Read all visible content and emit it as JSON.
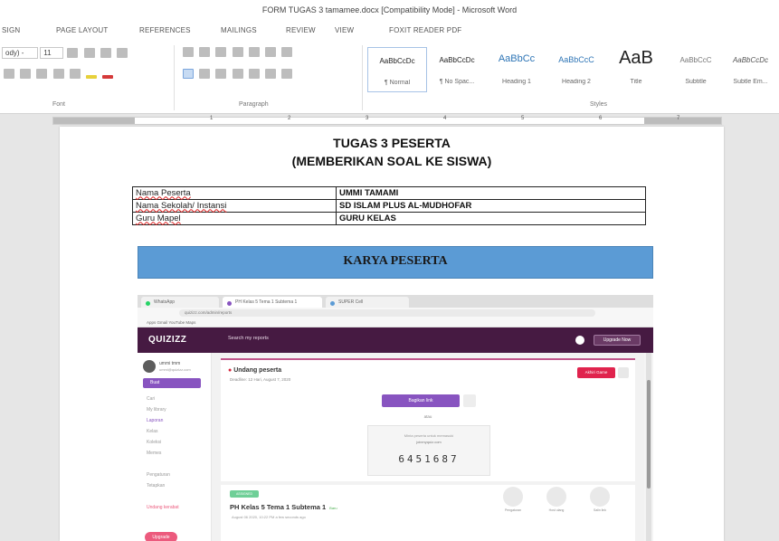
{
  "window": {
    "title": "FORM TUGAS 3 tamamee.docx [Compatibility Mode] - Microsoft Word"
  },
  "ribbon_tabs": [
    "SIGN",
    "PAGE LAYOUT",
    "REFERENCES",
    "MAILINGS",
    "REVIEW",
    "VIEW",
    "FOXIT READER PDF"
  ],
  "font_group": {
    "font_name": "ody) -",
    "font_size": "11",
    "label": "Font"
  },
  "paragraph_group": {
    "label": "Paragraph"
  },
  "styles_group": {
    "label": "Styles",
    "styles": [
      {
        "sample": "AaBbCcDc",
        "name": "¶ Normal"
      },
      {
        "sample": "AaBbCcDc",
        "name": "¶ No Spac..."
      },
      {
        "sample": "AaBbCc",
        "name": "Heading 1"
      },
      {
        "sample": "AaBbCcC",
        "name": "Heading 2"
      },
      {
        "sample": "AaB",
        "name": "Title"
      },
      {
        "sample": "AaBbCcC",
        "name": "Subtitle"
      },
      {
        "sample": "AaBbCcDc",
        "name": "Subtle Em..."
      }
    ]
  },
  "ruler": {
    "numbers": [
      "1",
      "2",
      "3",
      "4",
      "5",
      "6",
      "7"
    ]
  },
  "document": {
    "title_line1": "TUGAS 3 PESERTA",
    "title_line2": "(MEMBERIKAN SOAL KE SISWA)",
    "table": [
      {
        "label": "Nama Peserta",
        "value": "UMMI TAMAMI"
      },
      {
        "label": "Nama Sekolah/ Instansi",
        "value": "SD ISLAM PLUS AL-MUDHOFAR"
      },
      {
        "label": "Guru Mapel",
        "value": "GURU KELAS"
      }
    ],
    "karya_heading": "KARYA PESERTA"
  },
  "embedded_screenshot": {
    "browser_tabs": [
      "WhatsApp",
      "PH Kelas 5 Tema 1 Subtema 1",
      "SUPER Cell"
    ],
    "url": "quizizz.com/admin/reports",
    "bookmarks": "Apps  Gmail  YouTube  Maps",
    "quizizz": {
      "logo": "QUIZIZZ",
      "search": "Search my reports",
      "header_button": "Upgrade Now",
      "user_name": "ummi tmm",
      "user_email": "ummi@quizizz.com",
      "create_label": "Buat",
      "nav": [
        "Cari",
        "My library",
        "Laporan",
        "Kelas",
        "Koleksi",
        "Memes",
        "Pengaturan",
        "Tetapkan",
        "Undang kerabat"
      ],
      "upgrade": "Upgrade",
      "card_title": "Undang peserta",
      "card_deadline": "Deadline: 12 Hari, August 7, 2020",
      "stop_button": "Akhiri Game",
      "share_button": "Bagikan link",
      "or_text": "atau",
      "code_hint": "Minta peserta untuk memasuki",
      "code_url": "joinmyquiz.com",
      "game_code": "6451687",
      "quiz_badge": "ASSIGNED",
      "quiz_title": "PH Kelas 5 Tema 1 Subtema 1",
      "quiz_pill": "Baru",
      "quiz_date": "August 06 2020, 10:22 PM a few seconds ago",
      "actions": [
        "Pengaturan",
        "Host ulang",
        "Salin link"
      ]
    }
  }
}
